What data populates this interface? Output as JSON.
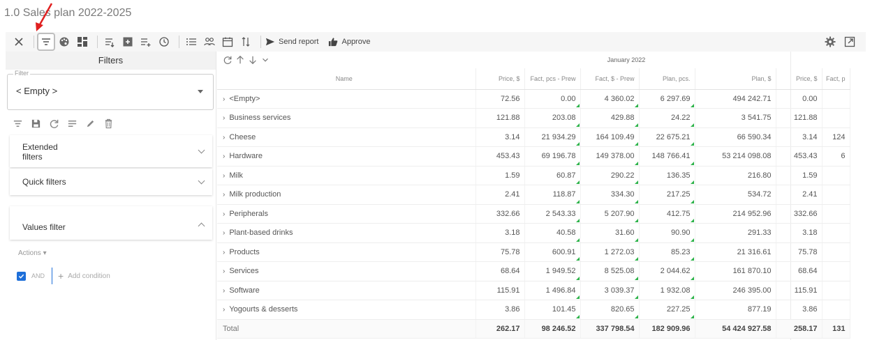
{
  "page_title": "1.0 Sales plan 2022-2025",
  "toolbar": {
    "send_report": "Send report",
    "approve": "Approve",
    "icons": [
      "close-icon",
      "filter-icon",
      "palette-icon",
      "layout-icon",
      "list-filter-icon",
      "grid-add-icon",
      "list-add-icon",
      "history-icon",
      "list-icon",
      "users-icon",
      "calendar-icon",
      "sort-icon",
      "send-icon",
      "thumbs-up-icon",
      "gear-icon",
      "expand-icon"
    ]
  },
  "filters_panel": {
    "title": "Filters",
    "filter_legend": "Filter",
    "filter_value": "< Empty >",
    "extended_filters": "Extended\nfilters",
    "quick_filters": "Quick filters",
    "values_filter": "Values filter",
    "actions_label": "Actions ▾",
    "and_label": "AND",
    "add_condition": "Add condition"
  },
  "grid": {
    "month": "January 2022",
    "columns": [
      "Name",
      "Price, $",
      "Fact, pcs - Prew",
      "Fact, $ - Prew",
      "Plan, pcs.",
      "Plan, $",
      "Price, $",
      "Fact, p"
    ],
    "rows": [
      {
        "name": "<Empty>",
        "c": [
          "72.56",
          "0.00",
          "4 360.02",
          "6 297.69",
          "494 242.71",
          "0.00",
          ""
        ]
      },
      {
        "name": "Business services",
        "c": [
          "121.88",
          "203.08",
          "429.88",
          "24.22",
          "3 541.75",
          "121.88",
          ""
        ]
      },
      {
        "name": "Cheese",
        "c": [
          "3.14",
          "21 934.29",
          "164 109.49",
          "22 675.21",
          "66 590.34",
          "3.14",
          "124"
        ]
      },
      {
        "name": "Hardware",
        "c": [
          "453.43",
          "69 196.78",
          "149 378.00",
          "148 766.41",
          "53 214 098.08",
          "453.43",
          "6"
        ]
      },
      {
        "name": "Milk",
        "c": [
          "1.59",
          "60.87",
          "290.22",
          "136.35",
          "216.80",
          "1.59",
          ""
        ]
      },
      {
        "name": "Milk production",
        "c": [
          "2.41",
          "118.87",
          "334.30",
          "217.25",
          "534.72",
          "2.41",
          ""
        ]
      },
      {
        "name": "Peripherals",
        "c": [
          "332.66",
          "2 543.33",
          "5 207.90",
          "412.75",
          "214 952.96",
          "332.66",
          ""
        ]
      },
      {
        "name": "Plant-based drinks",
        "c": [
          "3.18",
          "40.58",
          "31.60",
          "90.90",
          "291.33",
          "3.18",
          ""
        ]
      },
      {
        "name": "Products",
        "c": [
          "75.78",
          "600.91",
          "1 272.03",
          "85.23",
          "21 316.61",
          "75.78",
          ""
        ]
      },
      {
        "name": "Services",
        "c": [
          "68.64",
          "1 949.52",
          "8 525.08",
          "2 044.62",
          "161 870.10",
          "68.64",
          ""
        ]
      },
      {
        "name": "Software",
        "c": [
          "115.91",
          "1 496.84",
          "3 039.37",
          "1 932.08",
          "246 395.00",
          "115.91",
          ""
        ]
      },
      {
        "name": "Yogourts & desserts",
        "c": [
          "3.86",
          "101.45",
          "820.65",
          "227.25",
          "877.19",
          "3.86",
          ""
        ]
      }
    ],
    "total": {
      "name": "Total",
      "c": [
        "262.17",
        "98 246.52",
        "337 798.54",
        "182 909.96",
        "54 424 927.58",
        "258.17",
        "131"
      ]
    }
  }
}
